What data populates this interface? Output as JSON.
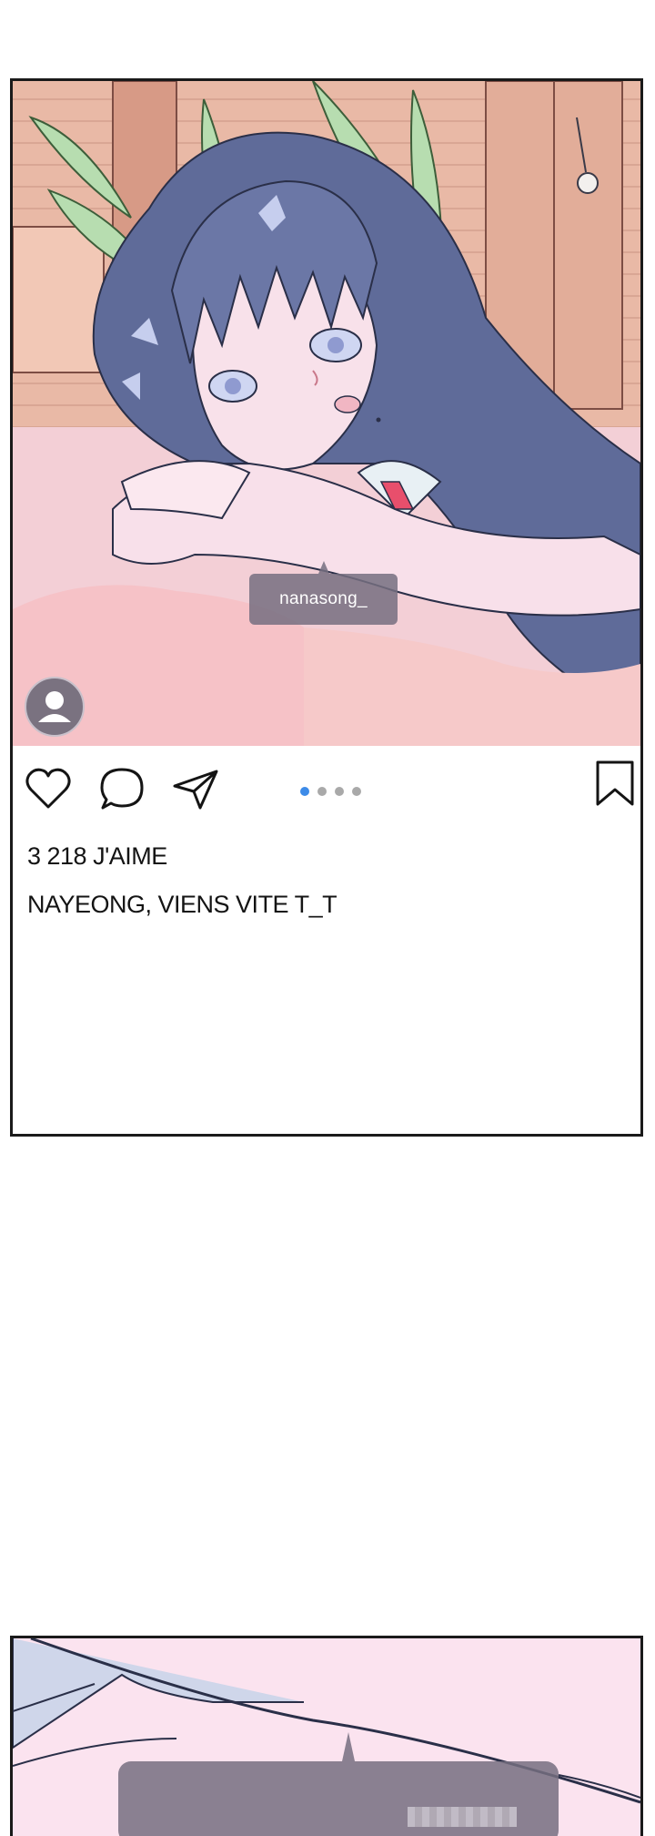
{
  "post": {
    "tag_username": "nanasong_",
    "likes_text": "3 218 J'AIME",
    "caption_text": "NAYEONG, VIENS VITE T_T",
    "carousel": {
      "count": 4,
      "active_index": 0
    },
    "icons": {
      "like": "heart-icon",
      "comment": "comment-bubble-icon",
      "share": "paper-plane-icon",
      "save": "bookmark-icon",
      "avatar": "user-avatar-icon"
    }
  },
  "colors": {
    "frame_border": "#1a1a1a",
    "tag_bubble": "#766e80",
    "active_dot": "#3d8be8",
    "inactive_dot": "#a9a9a9",
    "text": "#141414"
  }
}
